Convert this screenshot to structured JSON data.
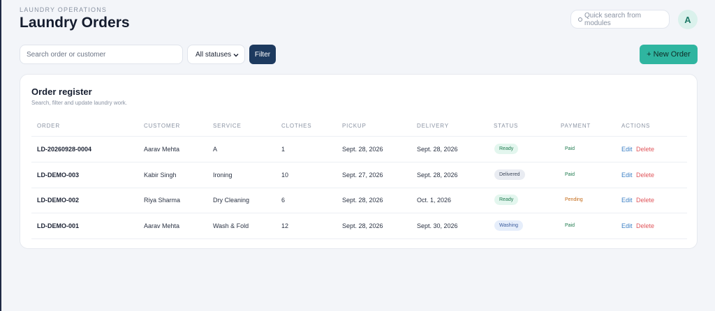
{
  "header": {
    "eyebrow": "LAUNDRY OPERATIONS",
    "title": "Laundry Orders",
    "quick_search_placeholder": "Quick search from modules",
    "avatar_initial": "A"
  },
  "toolbar": {
    "search_placeholder": "Search order or customer",
    "status_filter_value": "All statuses",
    "filter_label": "Filter",
    "new_order_label": "+ New Order"
  },
  "card": {
    "title": "Order register",
    "subtitle": "Search, filter and update laundry work."
  },
  "table": {
    "columns": [
      "ORDER",
      "CUSTOMER",
      "SERVICE",
      "CLOTHES",
      "PICKUP",
      "DELIVERY",
      "STATUS",
      "PAYMENT",
      "ACTIONS"
    ],
    "rows": [
      {
        "order": "LD-20260928-0004",
        "customer": "Aarav Mehta",
        "service": "A",
        "clothes": "1",
        "pickup": "Sept. 28, 2026",
        "delivery": "Sept. 28, 2026",
        "status": "Ready",
        "payment": "Paid",
        "edit": "Edit",
        "delete": "Delete"
      },
      {
        "order": "LD-DEMO-003",
        "customer": "Kabir Singh",
        "service": "Ironing",
        "clothes": "10",
        "pickup": "Sept. 27, 2026",
        "delivery": "Sept. 28, 2026",
        "status": "Delivered",
        "payment": "Paid",
        "edit": "Edit",
        "delete": "Delete"
      },
      {
        "order": "LD-DEMO-002",
        "customer": "Riya Sharma",
        "service": "Dry Cleaning",
        "clothes": "6",
        "pickup": "Sept. 28, 2026",
        "delivery": "Oct. 1, 2026",
        "status": "Ready",
        "payment": "Pending",
        "edit": "Edit",
        "delete": "Delete"
      },
      {
        "order": "LD-DEMO-001",
        "customer": "Aarav Mehta",
        "service": "Wash & Fold",
        "clothes": "12",
        "pickup": "Sept. 28, 2026",
        "delivery": "Sept. 30, 2026",
        "status": "Washing",
        "payment": "Paid",
        "edit": "Edit",
        "delete": "Delete"
      }
    ]
  },
  "colors": {
    "primary_dark": "#1d3a5f",
    "accent_teal": "#2fb5a0",
    "status_ready": "#1e7a4e",
    "payment_pending": "#c46a18",
    "action_edit": "#3b7fc4",
    "action_delete": "#e0565b"
  }
}
